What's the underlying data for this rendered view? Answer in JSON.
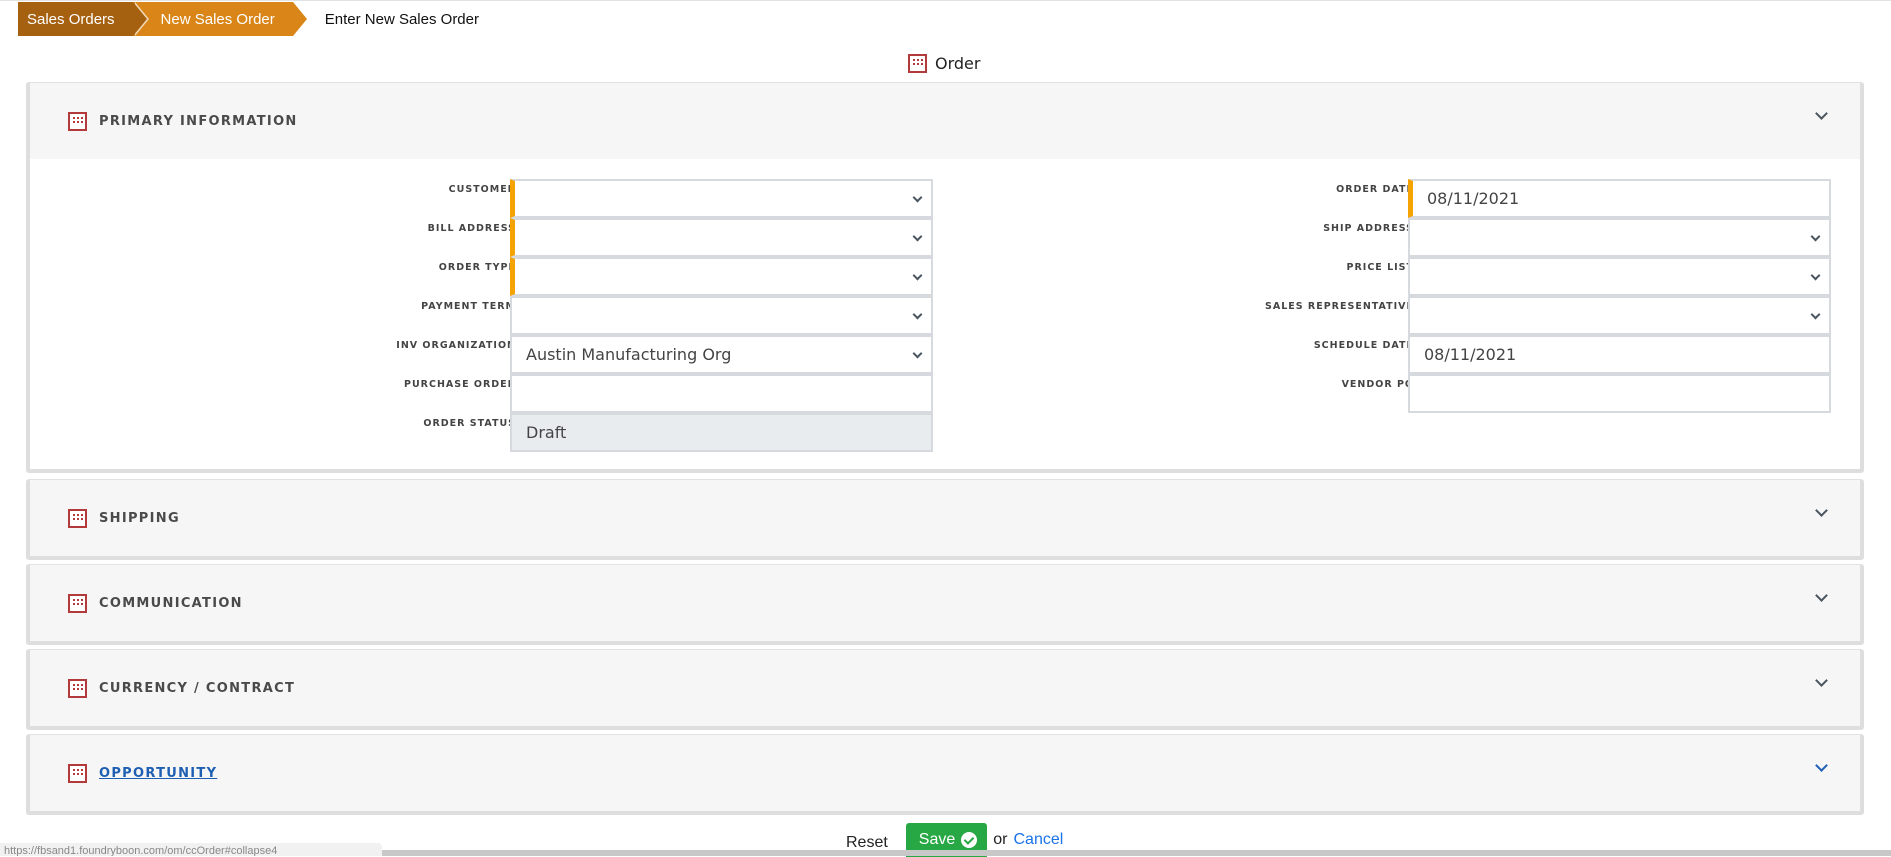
{
  "breadcrumb": {
    "items": [
      "Sales Orders",
      "New Sales Order"
    ],
    "current": "Enter New Sales Order"
  },
  "form": {
    "title": "Order",
    "title_icon": "grid-icon"
  },
  "colors": {
    "crumb_dark": "#a56010",
    "crumb_light": "#d98517",
    "required_marker": "#f5a300",
    "section_icon": "#b33a3a",
    "save_button": "#28a745",
    "link": "#1f5fb3"
  },
  "sections": [
    {
      "title": "PRIMARY INFORMATION",
      "expanded": true,
      "link": false
    },
    {
      "title": "SHIPPING",
      "expanded": false,
      "link": false
    },
    {
      "title": "COMMUNICATION",
      "expanded": false,
      "link": false
    },
    {
      "title": "CURRENCY / CONTRACT",
      "expanded": false,
      "link": false
    },
    {
      "title": "OPPORTUNITY",
      "expanded": false,
      "link": true
    }
  ],
  "primary": {
    "left": [
      {
        "label": "CUSTOMER",
        "value": "",
        "type": "select",
        "required": true
      },
      {
        "label": "BILL ADDRESS",
        "value": "",
        "type": "select",
        "required": true
      },
      {
        "label": "ORDER TYPE",
        "value": "",
        "type": "select",
        "required": true
      },
      {
        "label": "PAYMENT TERM",
        "value": "",
        "type": "select",
        "required": false
      },
      {
        "label": "INV ORGANIZATION",
        "value": "Austin Manufacturing Org",
        "type": "select",
        "required": false
      },
      {
        "label": "PURCHASE ORDER",
        "value": "",
        "type": "text",
        "required": false
      },
      {
        "label": "ORDER STATUS",
        "value": "Draft",
        "type": "readonly",
        "required": false
      }
    ],
    "right": [
      {
        "label": "ORDER DATE",
        "value": "08/11/2021",
        "type": "text",
        "required": true
      },
      {
        "label": "SHIP ADDRESS",
        "value": "",
        "type": "select",
        "required": false
      },
      {
        "label": "PRICE LIST",
        "value": "",
        "type": "select",
        "required": false
      },
      {
        "label": "SALES REPRESENTATIVE",
        "value": "",
        "type": "select",
        "required": false
      },
      {
        "label": "SCHEDULE DATE",
        "value": "08/11/2021",
        "type": "text",
        "required": false
      },
      {
        "label": "VENDOR PO",
        "value": "",
        "type": "text",
        "required": false
      }
    ]
  },
  "actions": {
    "reset": "Reset",
    "save": "Save",
    "or": "or",
    "cancel": "Cancel"
  },
  "status_bar": {
    "url": "https://fbsand1.foundryboon.com/om/ccOrder#collapse4"
  }
}
